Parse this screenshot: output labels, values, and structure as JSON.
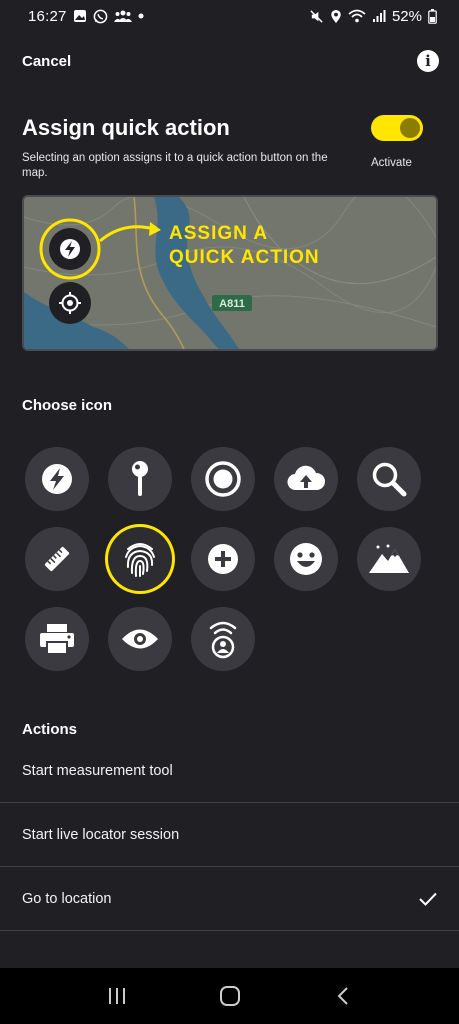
{
  "status_bar": {
    "time": "16:27",
    "battery": "52%",
    "left_icons": [
      "gallery-icon",
      "whatsapp-icon",
      "group-icon",
      "dot-icon"
    ],
    "right_icons": [
      "mute-icon",
      "location-icon",
      "wifi-icon",
      "signal-icon",
      "battery-icon"
    ]
  },
  "header": {
    "cancel_label": "Cancel",
    "info_label": "i"
  },
  "title": "Assign quick action",
  "subtitle": "Selecting an option assigns it to a quick action button on the map.",
  "toggle": {
    "label": "Activate",
    "on": true
  },
  "preview": {
    "callout": [
      "ASSIGN A",
      "QUICK ACTION"
    ],
    "road_label": "A811"
  },
  "choose_icon": {
    "heading": "Choose icon",
    "selected": "fingerprint-icon",
    "icons": [
      "lightning-icon",
      "pin-icon",
      "record-icon",
      "cloud-upload-icon",
      "search-icon",
      "ruler-icon",
      "fingerprint-icon",
      "add-circle-icon",
      "smiley-icon",
      "mountain-icon",
      "printer-icon",
      "eye-icon",
      "live-locator-icon"
    ]
  },
  "actions": {
    "heading": "Actions",
    "items": [
      {
        "label": "Start measurement tool",
        "checked": false
      },
      {
        "label": "Start live locator session",
        "checked": false
      },
      {
        "label": "Go to location",
        "checked": true
      }
    ]
  },
  "colors": {
    "background": "#1f1f24",
    "accent": "#ffe600",
    "icon_bg": "#3a3a40",
    "divider": "#3f3f45"
  }
}
